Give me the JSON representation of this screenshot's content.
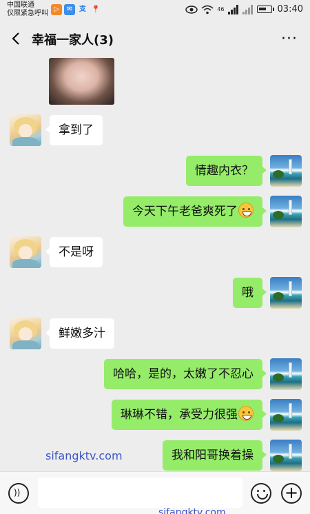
{
  "status_bar": {
    "carrier_line1": "中国联通",
    "carrier_line2": "仅限紧急呼叫",
    "apps": [
      "▷",
      "✉",
      "支",
      "📍"
    ],
    "network": "46",
    "time": "03:40"
  },
  "header": {
    "title": "幸福一家人(3)",
    "more": "···",
    "back_icon": "chevron-left-icon"
  },
  "messages": [
    {
      "side": "left",
      "text": "拿到了"
    },
    {
      "side": "right",
      "text": "情趣内衣？"
    },
    {
      "side": "right",
      "text": "今天下午老爸爽死了",
      "emoji": "blushing-face"
    },
    {
      "side": "left",
      "text": "不是呀"
    },
    {
      "side": "right",
      "text": "哦"
    },
    {
      "side": "left",
      "text": "鲜嫩多汁"
    },
    {
      "side": "right",
      "text": "哈哈，是的，太嫩了不忍心"
    },
    {
      "side": "right",
      "text": "琳琳不错，承受力很强",
      "emoji": "grinning-face"
    },
    {
      "side": "right",
      "text": "我和阳哥换着操"
    }
  ],
  "watermark": "sifangktv.com",
  "watermark_bottom": "sifangktv.com",
  "input_bar": {
    "voice_icon": "voice-icon",
    "emoji_icon": "emoji-icon",
    "plus_icon": "plus-icon",
    "plus_label": "+"
  }
}
